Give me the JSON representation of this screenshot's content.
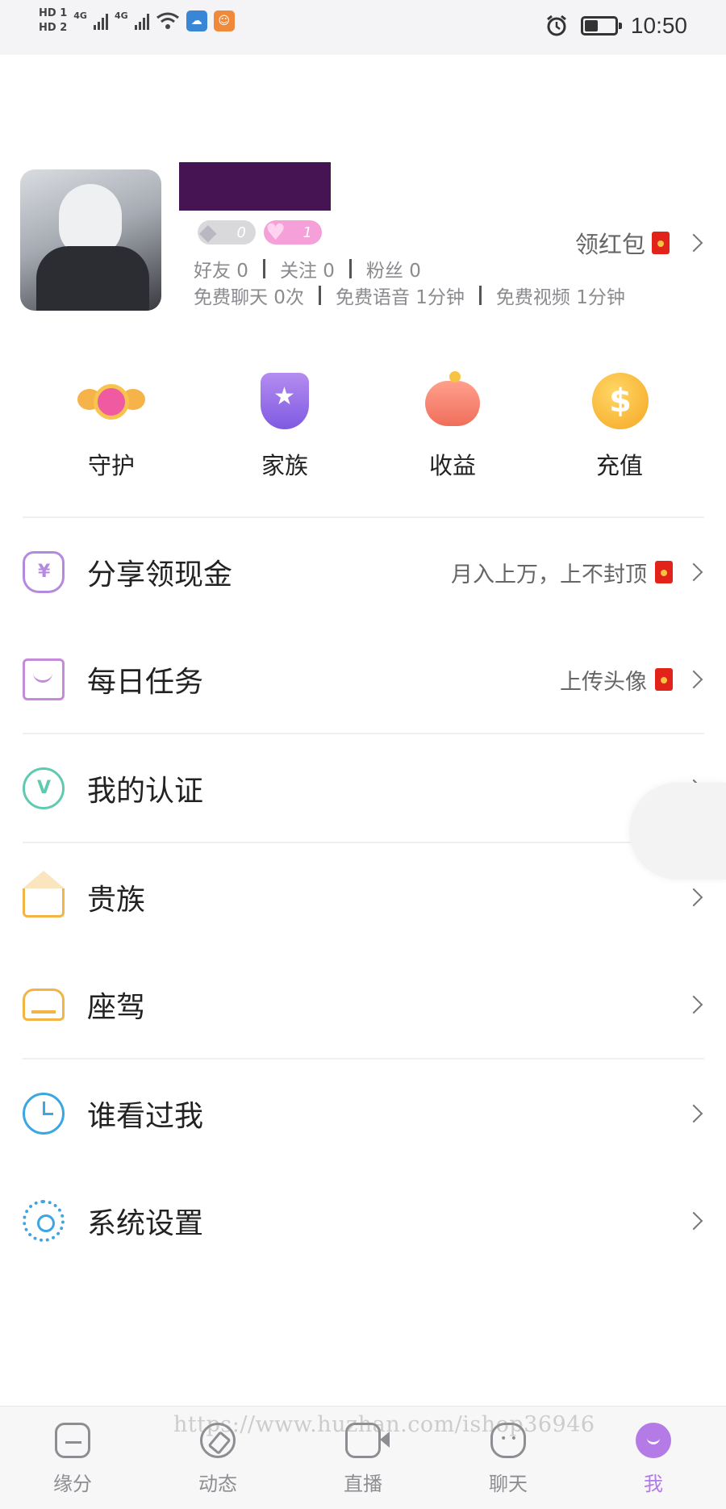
{
  "status_bar": {
    "hd1": "HD 1",
    "hd2": "HD 2",
    "net1": "4G",
    "net2": "4G",
    "time": "10:50"
  },
  "profile": {
    "badge_diamond_count": "0",
    "badge_heart_count": "1",
    "friends": "好友 0",
    "following": "关注 0",
    "fans": "粉丝 0",
    "free_chat": "免费聊天 0次",
    "free_voice": "免费语音 1分钟",
    "free_video": "免费视频 1分钟",
    "red_packet_label": "领红包"
  },
  "quick_actions": [
    {
      "label": "守护",
      "icon": "guard-heart-icon"
    },
    {
      "label": "家族",
      "icon": "family-shield-icon"
    },
    {
      "label": "收益",
      "icon": "piggy-bank-icon"
    },
    {
      "label": "充值",
      "icon": "dollar-coin-icon"
    }
  ],
  "menu": [
    {
      "label": "分享领现金",
      "hint": "月入上万，上不封顶",
      "icon": "money-bag-icon"
    },
    {
      "label": "每日任务",
      "hint": "上传头像",
      "icon": "task-envelope-icon"
    },
    {
      "label": "我的认证",
      "hint": "",
      "icon": "verify-badge-icon"
    },
    {
      "label": "贵族",
      "hint": "",
      "icon": "crown-icon"
    },
    {
      "label": "座驾",
      "hint": "",
      "icon": "car-icon"
    },
    {
      "label": "谁看过我",
      "hint": "",
      "icon": "visitor-clock-icon"
    },
    {
      "label": "系统设置",
      "hint": "",
      "icon": "settings-gear-icon"
    }
  ],
  "tabbar": [
    {
      "label": "缘分",
      "icon": "home-icon"
    },
    {
      "label": "动态",
      "icon": "compass-icon"
    },
    {
      "label": "直播",
      "icon": "video-camera-icon"
    },
    {
      "label": "聊天",
      "icon": "chat-bubble-icon"
    },
    {
      "label": "我",
      "icon": "me-smile-icon"
    }
  ],
  "watermark": "https://www.huzhan.com/ishop36946",
  "colors": {
    "accent": "#b47ae6",
    "redacted": "#461452",
    "divider": "#efefef"
  }
}
